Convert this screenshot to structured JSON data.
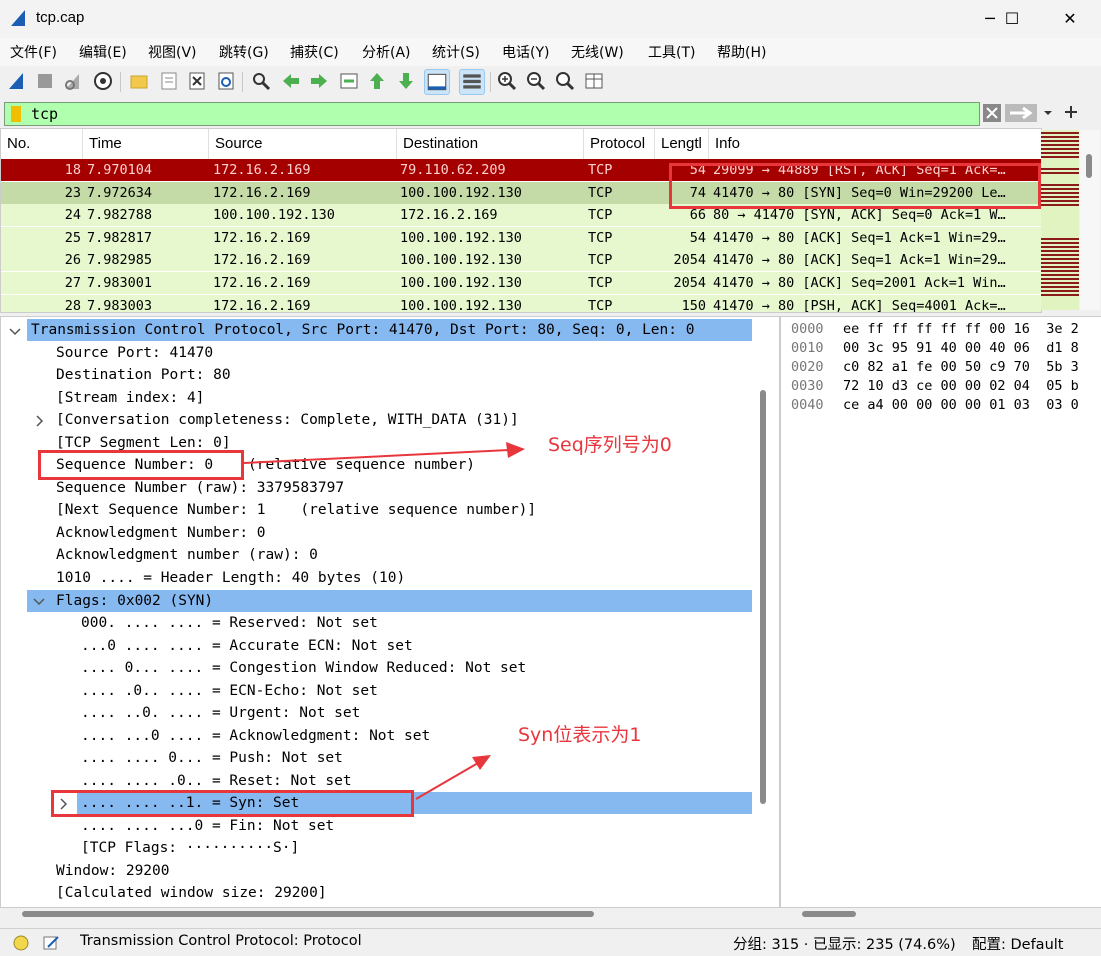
{
  "window": {
    "title": "tcp.cap",
    "minimize": "─",
    "maximize": "☐",
    "close": "✕"
  },
  "menu": [
    "文件(F)",
    "编辑(E)",
    "视图(V)",
    "跳转(G)",
    "捕获(C)",
    "分析(A)",
    "统计(S)",
    "电话(Y)",
    "无线(W)",
    "工具(T)",
    "帮助(H)"
  ],
  "toolbar_icons": [
    "start-capture-icon",
    "stop-capture-icon",
    "restart-capture-icon",
    "capture-options-icon",
    "open-file-icon",
    "save-file-icon",
    "close-file-icon",
    "reload-file-icon",
    "find-packet-icon",
    "go-back-icon",
    "go-forward-icon",
    "go-to-packet-icon",
    "go-first-icon",
    "go-last-icon",
    "auto-scroll-icon",
    "colorize-icon",
    "zoom-in-icon",
    "zoom-out-icon",
    "normal-size-icon",
    "resize-columns-icon"
  ],
  "filter": {
    "value": "tcp"
  },
  "packet_list": {
    "columns": [
      "No.",
      "Time",
      "Source",
      "Destination",
      "Protocol",
      "Lengtl",
      "Info"
    ],
    "rows": [
      {
        "no": "18",
        "time": "7.970104",
        "src": "172.16.2.169",
        "dst": "79.110.62.209",
        "proto": "TCP",
        "len": "54",
        "info": "29099 → 44889 [RST, ACK] Seq=1 Ack=…",
        "style": "rst"
      },
      {
        "no": "23",
        "time": "7.972634",
        "src": "172.16.2.169",
        "dst": "100.100.192.130",
        "proto": "TCP",
        "len": "74",
        "info": "41470 → 80 [SYN] Seq=0 Win=29200 Le…",
        "style": "selected"
      },
      {
        "no": "24",
        "time": "7.982788",
        "src": "100.100.192.130",
        "dst": "172.16.2.169",
        "proto": "TCP",
        "len": "66",
        "info": "80 → 41470 [SYN, ACK] Seq=0 Ack=1 W…",
        "style": "normal"
      },
      {
        "no": "25",
        "time": "7.982817",
        "src": "172.16.2.169",
        "dst": "100.100.192.130",
        "proto": "TCP",
        "len": "54",
        "info": "41470 → 80 [ACK] Seq=1 Ack=1 Win=29…",
        "style": "normal"
      },
      {
        "no": "26",
        "time": "7.982985",
        "src": "172.16.2.169",
        "dst": "100.100.192.130",
        "proto": "TCP",
        "len": "2054",
        "info": "41470 → 80 [ACK] Seq=1 Ack=1 Win=29…",
        "style": "normal"
      },
      {
        "no": "27",
        "time": "7.983001",
        "src": "172.16.2.169",
        "dst": "100.100.192.130",
        "proto": "TCP",
        "len": "2054",
        "info": "41470 → 80 [ACK] Seq=2001 Ack=1 Win…",
        "style": "normal"
      },
      {
        "no": "28",
        "time": "7.983003",
        "src": "172.16.2.169",
        "dst": "100.100.192.130",
        "proto": "TCP",
        "len": "150",
        "info": "41470 → 80 [PSH, ACK] Seq=4001 Ack=…",
        "style": "normal"
      }
    ]
  },
  "details": [
    "Transmission Control Protocol, Src Port: 41470, Dst Port: 80, Seq: 0, Len: 0",
    "Source Port: 41470",
    "Destination Port: 80",
    "[Stream index: 4]",
    "[Conversation completeness: Complete, WITH_DATA (31)]",
    "[TCP Segment Len: 0]",
    "Sequence Number: 0    (relative sequence number)",
    "Sequence Number (raw): 3379583797",
    "[Next Sequence Number: 1    (relative sequence number)]",
    "Acknowledgment Number: 0",
    "Acknowledgment number (raw): 0",
    "1010 .... = Header Length: 40 bytes (10)",
    "Flags: 0x002 (SYN)",
    "000. .... .... = Reserved: Not set",
    "...0 .... .... = Accurate ECN: Not set",
    ".... 0... .... = Congestion Window Reduced: Not set",
    ".... .0.. .... = ECN-Echo: Not set",
    ".... ..0. .... = Urgent: Not set",
    ".... ...0 .... = Acknowledgment: Not set",
    ".... .... 0... = Push: Not set",
    ".... .... .0.. = Reset: Not set",
    ".... .... ..1. = Syn: Set",
    ".... .... ...0 = Fin: Not set",
    "[TCP Flags: ··········S·]",
    "Window: 29200",
    "[Calculated window size: 29200]"
  ],
  "hex": {
    "offsets": [
      "0000",
      "0010",
      "0020",
      "0030",
      "0040"
    ],
    "bytes": [
      "ee ff ff ff ff ff 00 16  3e 2",
      "00 3c 95 91 40 00 40 06  d1 8",
      "c0 82 a1 fe 00 50 c9 70  5b 3",
      "72 10 d3 ce 00 00 02 04  05 b",
      "ce a4 00 00 00 00 01 03  03 0"
    ]
  },
  "status": {
    "field": "Transmission Control Protocol: Protocol",
    "packets": "分组: 315 · 已显示: 235 (74.6%)",
    "profile": "配置: Default"
  },
  "annotations": {
    "seq": "Seq序列号为0",
    "syn": "Syn位表示为1"
  },
  "colors": {
    "rst_row": "#a40000",
    "selected_row": "#c5dba7",
    "tcp_row": "#e7f8cf",
    "highlight": "#87b9f1",
    "annotation": "#e8363d",
    "filter_ok": "#afffaf"
  }
}
